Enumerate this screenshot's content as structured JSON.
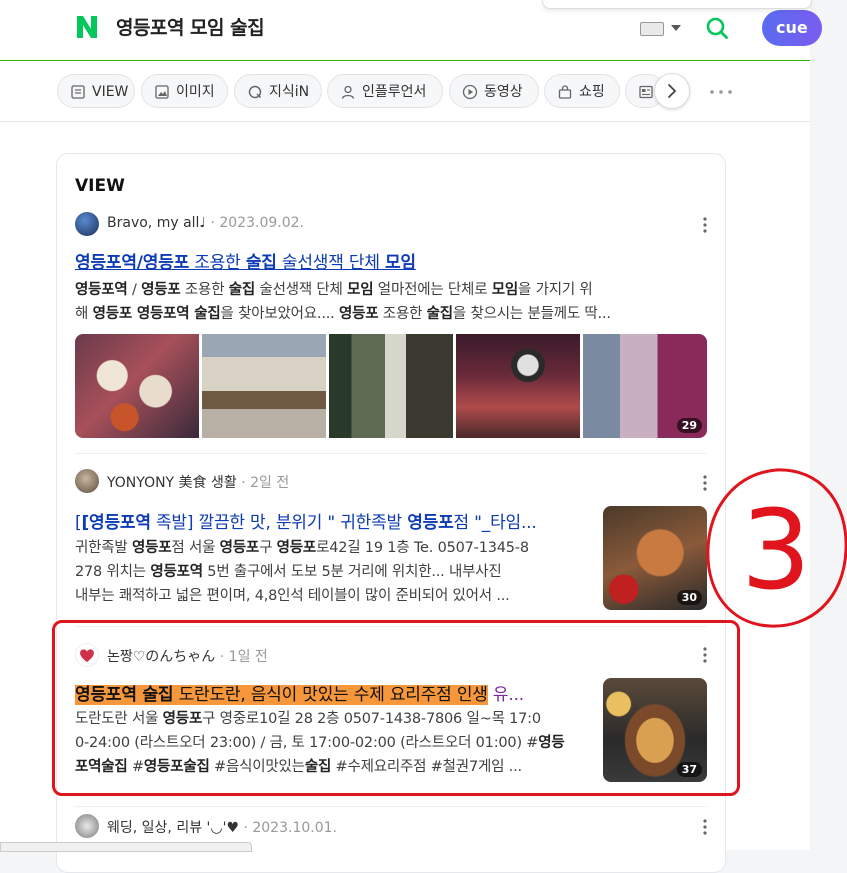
{
  "header": {
    "query": "영등포역 모임 술집",
    "cue_label": "cue"
  },
  "tabs": [
    {
      "label": "VIEW",
      "icon": "document-icon"
    },
    {
      "label": "이미지",
      "icon": "image-icon"
    },
    {
      "label": "지식iN",
      "icon": "q-icon"
    },
    {
      "label": "인플루언서",
      "icon": "person-icon"
    },
    {
      "label": "동영상",
      "icon": "play-icon"
    },
    {
      "label": "쇼핑",
      "icon": "bag-icon"
    }
  ],
  "section": {
    "title": "VIEW"
  },
  "posts": [
    {
      "author": "Bravo, my all♩",
      "date": "2023.09.02.",
      "title": [
        "영등포역/영등포",
        " 조용한 ",
        "술집",
        " 술선생잭 단체 ",
        "모임"
      ],
      "desc1": [
        "영등포역",
        " / ",
        "영등포",
        " 조용한 ",
        "술집",
        " 술선생잭 단체 ",
        "모임",
        " 얼마전에는 단체로 ",
        "모임",
        "을 가지기 위"
      ],
      "desc2": [
        "해 ",
        "영등포 영등포역 술집",
        "을 찾아보았어요.... ",
        "영등포",
        " 조용한 ",
        "술집",
        "을 찾으시는 분들께도 딱..."
      ],
      "photo_count": "29"
    },
    {
      "author": "YONYONY 美食 생활",
      "date": "2일 전",
      "title": [
        "[영등포역",
        " 족발] 깔끔한 맛, 분위기 \" 귀한족발 ",
        "영등포",
        "점 \"_타임..."
      ],
      "desc1": [
        "귀한족발 ",
        "영등포",
        "점 서울 ",
        "영등포",
        "구 ",
        "영등포",
        "로42길 19 1층 Te. 0507-1345-8"
      ],
      "desc2": [
        "278 위치는 ",
        "영등포역",
        " 5번 출구에서 도보 5분 거리에 위치한... 내부사진"
      ],
      "desc3": [
        "내부는 쾌적하고 넓은 편이며, 4,8인석 테이블이 많이 준비되어 있어서 ..."
      ],
      "photo_count": "30"
    },
    {
      "author": "논짱♡のんちゃん",
      "date": "1일 전",
      "title": [
        "영등포역 술집",
        " 도란도란, 음식이 맛있는 수제 요리주점 인생",
        " 유..."
      ],
      "desc1": [
        "도란도란 서울 ",
        "영등포",
        "구 영중로10길 28 2층 0507-1438-7806 일~목 17:0"
      ],
      "desc2": [
        "0-24:00 (라스트오더 23:00) / 금, 토 17:00-02:00 (라스트오더 01:00) #",
        "영등"
      ],
      "desc3": [
        "포역술집",
        " #",
        "영등포술집",
        " #음식이맛있는",
        "술집",
        " #수제요리주점 #철권7게임 ..."
      ],
      "photo_count": "37"
    },
    {
      "author": "웨딩, 일상, 리뷰 '◡'♥",
      "date": "2023.10.01."
    }
  ],
  "annotation": {
    "label": "3",
    "color": "#e0141c"
  },
  "colors": {
    "brand_green": "#2db400",
    "link_blue": "#0c3bb5",
    "highlight": "#f5973a"
  }
}
